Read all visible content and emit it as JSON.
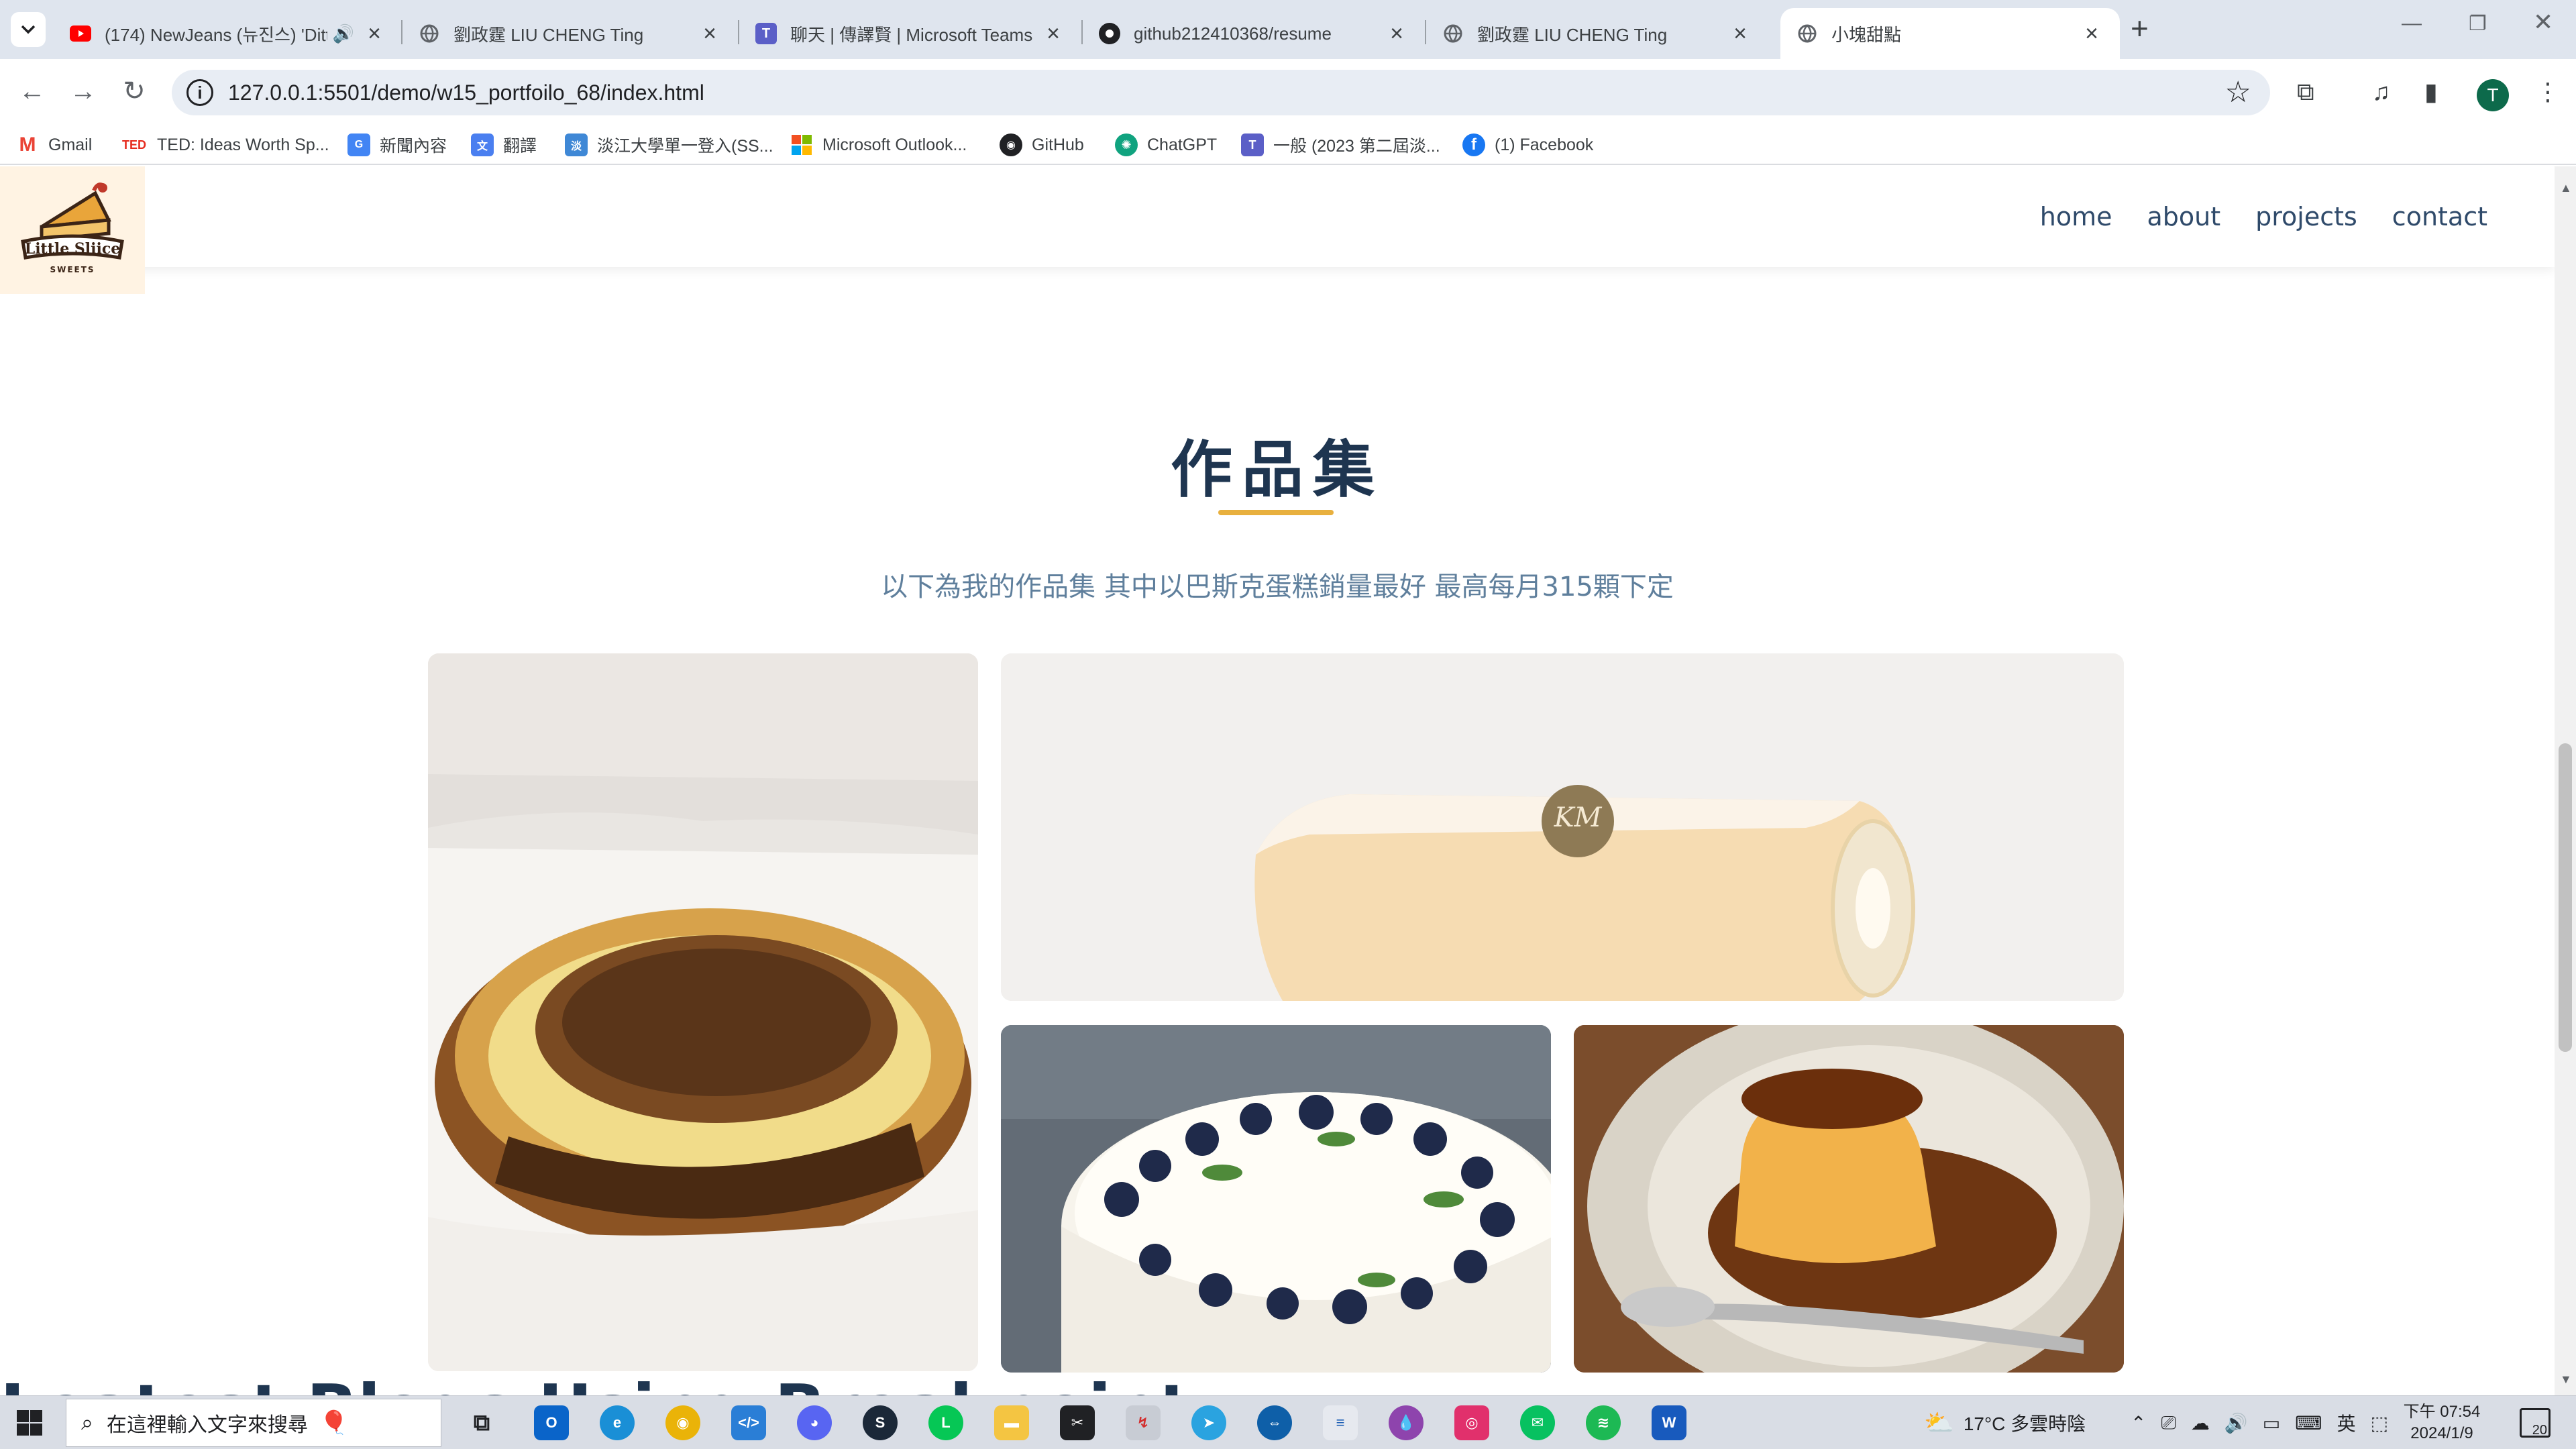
{
  "browser": {
    "tabs": [
      {
        "title": "(174) NewJeans (뉴진스) 'Ditt",
        "icon": "youtube-icon",
        "audio": true
      },
      {
        "title": "劉政霆 LIU CHENG Ting",
        "icon": "globe-icon"
      },
      {
        "title": "聊天 | 傳譯賢 | Microsoft Teams",
        "icon": "teams-icon"
      },
      {
        "title": "github212410368/resume",
        "icon": "github-icon"
      },
      {
        "title": "劉政霆 LIU CHENG Ting",
        "icon": "globe-icon"
      },
      {
        "title": "小塊甜點",
        "icon": "globe-icon",
        "active": true
      }
    ],
    "new_tab_label": "+",
    "url": "127.0.0.1:5501/demo/w15_portfoilo_68/index.html",
    "profile_initial": "T",
    "bookmarks": [
      {
        "label": "Gmail",
        "icon": "gmail-icon"
      },
      {
        "label": "TED: Ideas Worth Sp...",
        "icon": "ted-icon"
      },
      {
        "label": "新聞內容",
        "icon": "news-icon"
      },
      {
        "label": "翻譯",
        "icon": "translate-icon"
      },
      {
        "label": "淡江大學單一登入(SS...",
        "icon": "tku-icon"
      },
      {
        "label": "Microsoft Outlook...",
        "icon": "microsoft-icon"
      },
      {
        "label": "GitHub",
        "icon": "github-icon"
      },
      {
        "label": "ChatGPT",
        "icon": "chatgpt-icon"
      },
      {
        "label": "一般 (2023 第二屆淡...",
        "icon": "teams-icon"
      },
      {
        "label": "(1) Facebook",
        "icon": "facebook-icon"
      }
    ]
  },
  "site": {
    "logo_line1": "Little Sliice",
    "logo_line2": "SWEETS",
    "nav": [
      "home",
      "about",
      "projects",
      "contact"
    ],
    "section_title": "作品集",
    "section_subtitle": "以下為我的作品集 其中以巴斯克蛋糕銷量最好 最高每月315顆下定",
    "gallery": [
      {
        "name": "basque-cheesecake-photo"
      },
      {
        "name": "swiss-roll-photo",
        "badge": "KM"
      },
      {
        "name": "blueberry-cake-photo"
      },
      {
        "name": "caramel-pudding-photo"
      }
    ],
    "next_heading": "Leatest Blogs Using Breakpoint"
  },
  "taskbar": {
    "search_placeholder": "在這裡輸入文字來搜尋",
    "weather": "17°C  多雲時陰",
    "ime": "英",
    "clock_time": "下午 07:54",
    "clock_date": "2024/1/9",
    "notification_count": "20"
  },
  "colors": {
    "accent": "#e8b03e",
    "heading": "#1e3550",
    "nav": "#2f4a6a",
    "subtitle": "#5f7f9c"
  }
}
